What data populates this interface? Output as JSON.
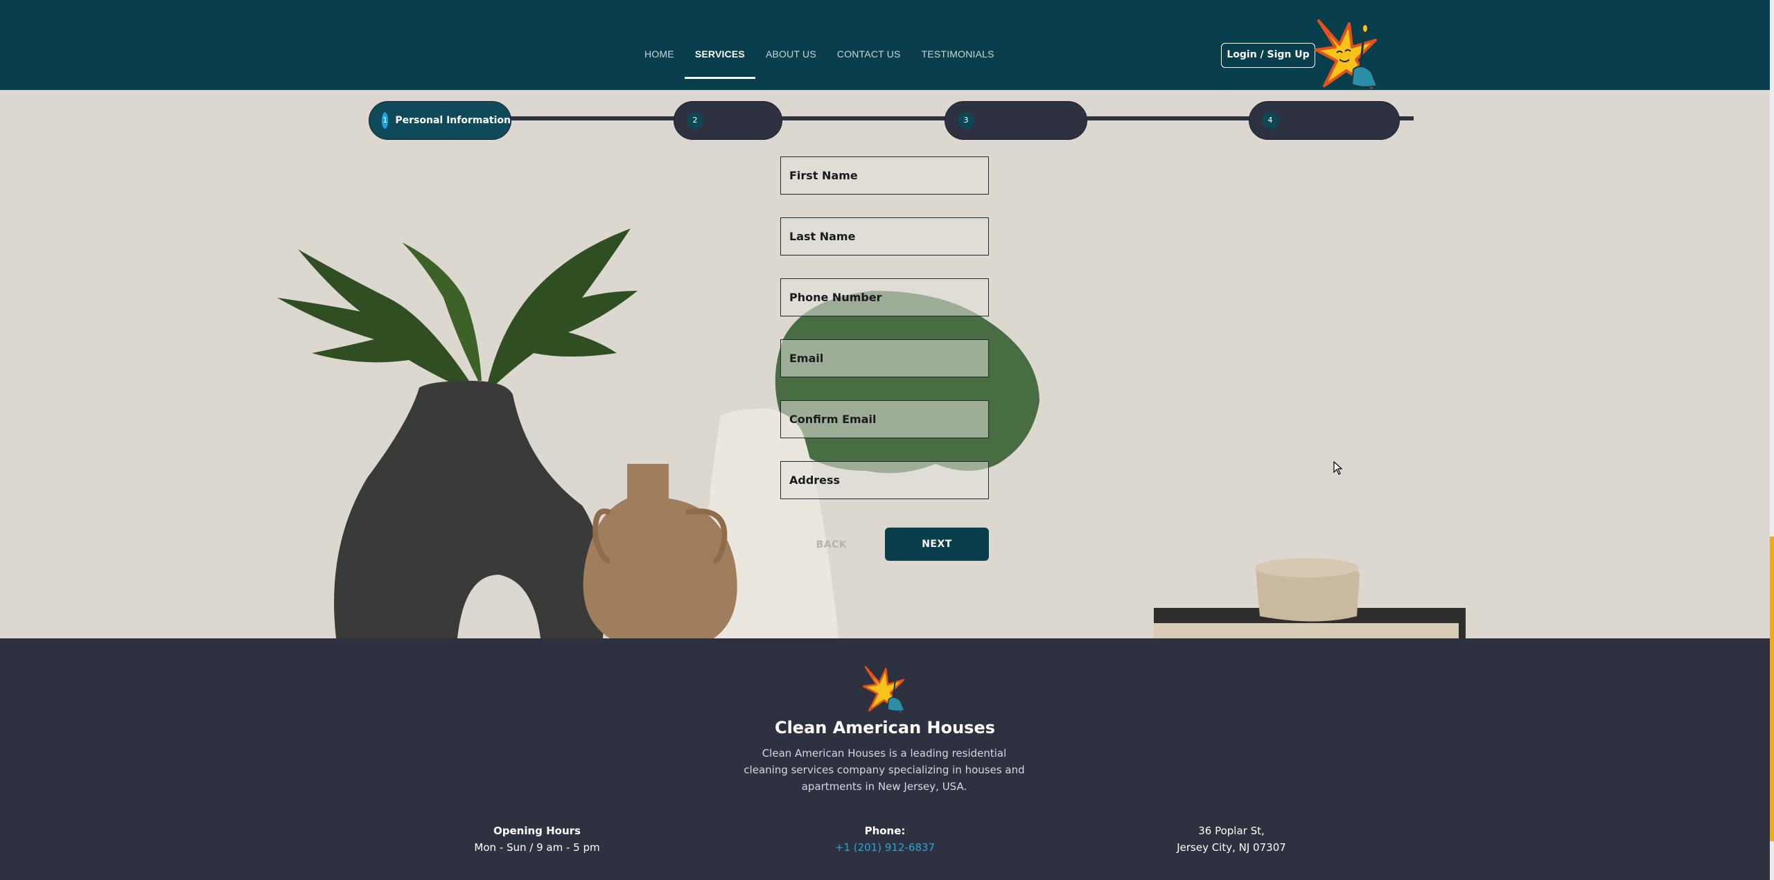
{
  "nav": {
    "items": [
      {
        "label": "HOME"
      },
      {
        "label": "SERVICES"
      },
      {
        "label": "ABOUT US"
      },
      {
        "label": "CONTACT US"
      },
      {
        "label": "TESTIMONIALS"
      }
    ],
    "active": "SERVICES",
    "login_label": "Login / Sign Up"
  },
  "stepper": {
    "steps": [
      {
        "number": "1",
        "label": "Personal Information",
        "active": true
      },
      {
        "number": "2",
        "label": "",
        "active": false
      },
      {
        "number": "3",
        "label": "",
        "active": false
      },
      {
        "number": "4",
        "label": "",
        "active": false
      }
    ]
  },
  "form": {
    "first_name": {
      "placeholder": "First Name",
      "value": ""
    },
    "last_name": {
      "placeholder": "Last Name",
      "value": ""
    },
    "phone": {
      "placeholder": "Phone Number",
      "value": ""
    },
    "email": {
      "placeholder": "Email",
      "value": ""
    },
    "confirm_email": {
      "placeholder": "Confirm Email",
      "value": ""
    },
    "address": {
      "placeholder": "Address",
      "value": ""
    },
    "back_label": "BACK",
    "next_label": "NEXT"
  },
  "footer": {
    "title": "Clean American Houses",
    "description": "Clean American Houses is a leading residential cleaning services company specializing in houses and apartments in New Jersey, USA.",
    "hours_heading": "Opening Hours",
    "hours_value": "Mon - Sun / 9 am - 5 pm",
    "phone_heading": "Phone:",
    "phone_value": "+1 (201) 912-6837",
    "address_line1": "36 Poplar St,",
    "address_line2": "Jersey City, NJ 07307"
  },
  "colors": {
    "header_bg": "#093f4d",
    "footer_bg": "#2e3140",
    "accent": "#1aa0e0",
    "link": "#2aa4d8",
    "scroll_thumb": "#f3a71a"
  },
  "icons": [
    "logo-icon",
    "cursor-icon"
  ]
}
